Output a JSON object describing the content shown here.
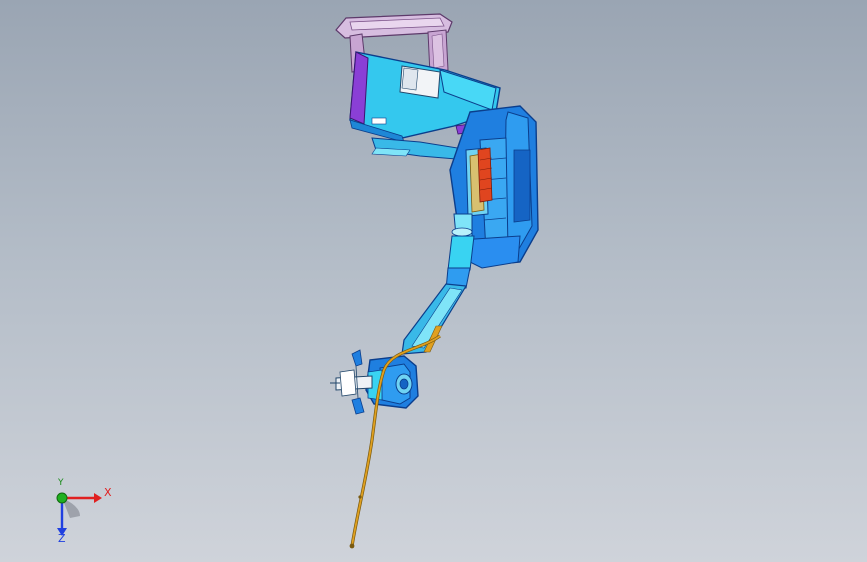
{
  "triad": {
    "x_label": "X",
    "y_label": "Y",
    "z_label": "Z"
  },
  "colors": {
    "background_top": "#9aa5b3",
    "background_bottom": "#cfd3da",
    "arm_primary": "#1f8fe6",
    "arm_light": "#39d3f2",
    "arm_edge": "#0b3e8c",
    "motor_purple": "#8a3fd6",
    "base_lilac": "#c9a8cf",
    "cable_orange": "#e0a01f",
    "axis_x": "#e02020",
    "axis_y": "#20b020",
    "axis_z": "#2040e0"
  },
  "model": {
    "name_icon": "robot-arm-model"
  }
}
